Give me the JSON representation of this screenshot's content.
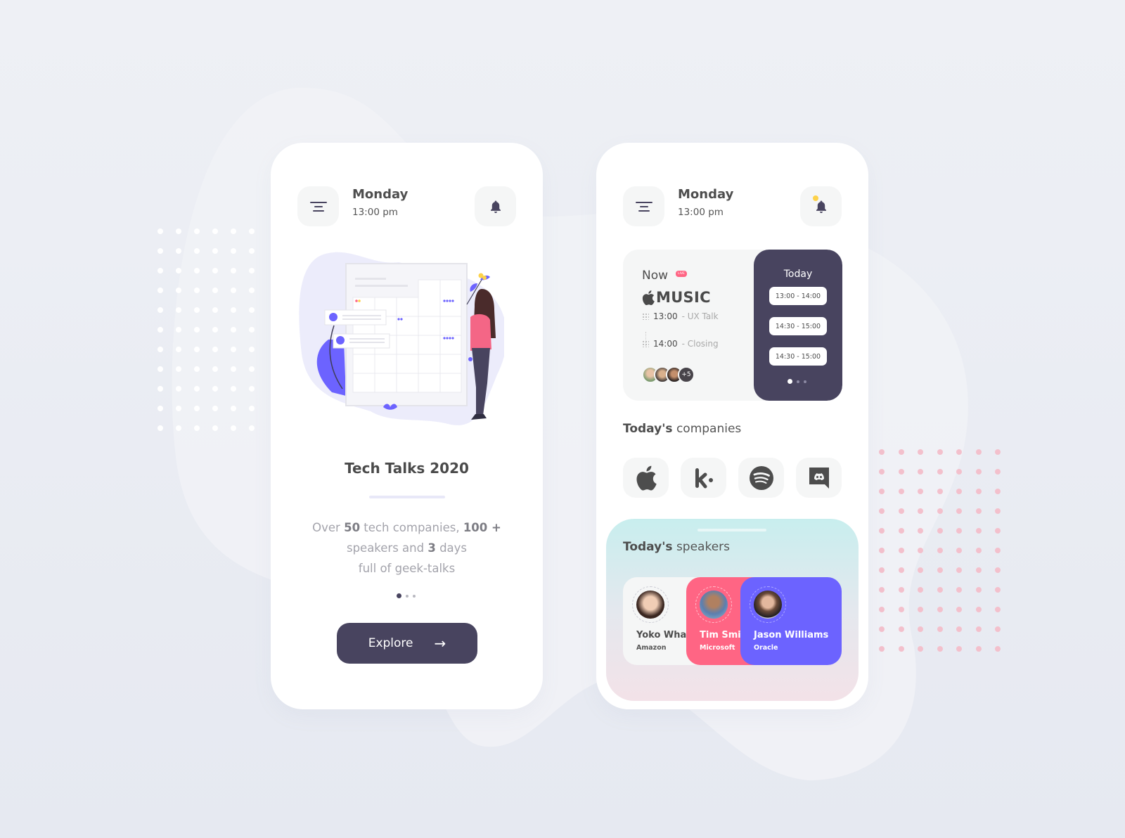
{
  "theme": {
    "primary": "#48445f",
    "accent_pink": "#ff6584",
    "accent_purple": "#6c63ff",
    "bell_dot": "#fdd24a"
  },
  "left_screen": {
    "header": {
      "menu_icon": "menu-lines-icon",
      "day": "Monday",
      "time": "13:00 pm",
      "notification_icon": "bell-icon"
    },
    "illustration": "woman-looking-at-calendar",
    "title": "Tech Talks 2020",
    "description": {
      "part1": "Over ",
      "num_companies": "50",
      "part2": " tech companies, ",
      "num_speakers": "100 +",
      "part3": " speakers and ",
      "num_days": "3",
      "part4": " days",
      "part5": "full of geek-talks"
    },
    "pager": {
      "pages": 3,
      "active": 1
    },
    "explore_button": {
      "label": "Explore",
      "icon": "arrow-right-icon",
      "arrow": "→"
    }
  },
  "right_screen": {
    "header": {
      "menu_icon": "menu-lines-icon",
      "day": "Monday",
      "time": "13:00 pm",
      "notification_icon": "bell-icon",
      "has_unread": true
    },
    "now_card": {
      "label": "Now",
      "badge": "LIVE",
      "brand_icon": "apple-icon",
      "brand_name": "MUSIC",
      "schedule": [
        {
          "time": "13:00",
          "title": "- UX Talk"
        },
        {
          "time": "14:00",
          "title": "- Closing"
        }
      ],
      "attendees_more": "+5"
    },
    "today_panel": {
      "title": "Today",
      "slots": [
        "13:00 - 14:00",
        "14:30 - 15:00",
        "14:30 - 15:00"
      ],
      "pager": {
        "pages": 3,
        "active": 1
      }
    },
    "companies": {
      "title_bold": "Today's",
      "title_rest": " companies",
      "items": [
        {
          "name": "Apple",
          "icon": "apple-icon"
        },
        {
          "name": "Kik",
          "icon": "kik-icon"
        },
        {
          "name": "Spotify",
          "icon": "spotify-icon"
        },
        {
          "name": "Discord",
          "icon": "discord-icon"
        }
      ]
    },
    "speakers": {
      "title_bold": "Today's",
      "title_rest": " speakers",
      "items": [
        {
          "name": "Yoko Wha",
          "company": "Amazon"
        },
        {
          "name": "Tim Smith",
          "company": "Microsoft"
        },
        {
          "name": "Jason Williams",
          "company": "Oracle"
        }
      ]
    }
  }
}
